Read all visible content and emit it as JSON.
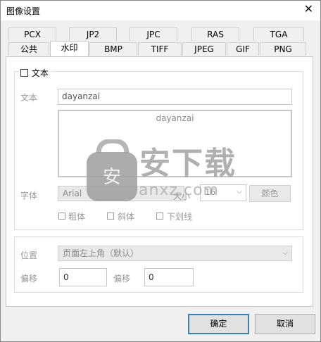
{
  "window": {
    "title": "图像设置"
  },
  "tabs_row1": [
    "PCX",
    "JP2",
    "JPC",
    "RAS",
    "TGA"
  ],
  "tabs_row2": [
    "公共",
    "水印",
    "BMP",
    "TIFF",
    "JPEG",
    "GIF",
    "PNG"
  ],
  "active_tab": "水印",
  "text_group": {
    "title": "文本",
    "text_label": "文本",
    "text_value": "dayanzai",
    "preview_text": "dayanzai",
    "font_label": "字体",
    "font_value": "Arial",
    "size_label": "大小",
    "size_value": "16",
    "color_button": "颜色",
    "bold_label": "粗体",
    "italic_label": "斜体",
    "underline_label": "下划线"
  },
  "position_group": {
    "position_label": "位置",
    "position_value": "页面左上角（默认）",
    "offset_label_1": "偏移",
    "offset_value_1": "0",
    "offset_label_2": "偏移",
    "offset_value_2": "0"
  },
  "buttons": {
    "ok": "确定",
    "cancel": "取消"
  },
  "watermark": {
    "logo_text": "安下载",
    "url_text": "anxz.com"
  }
}
